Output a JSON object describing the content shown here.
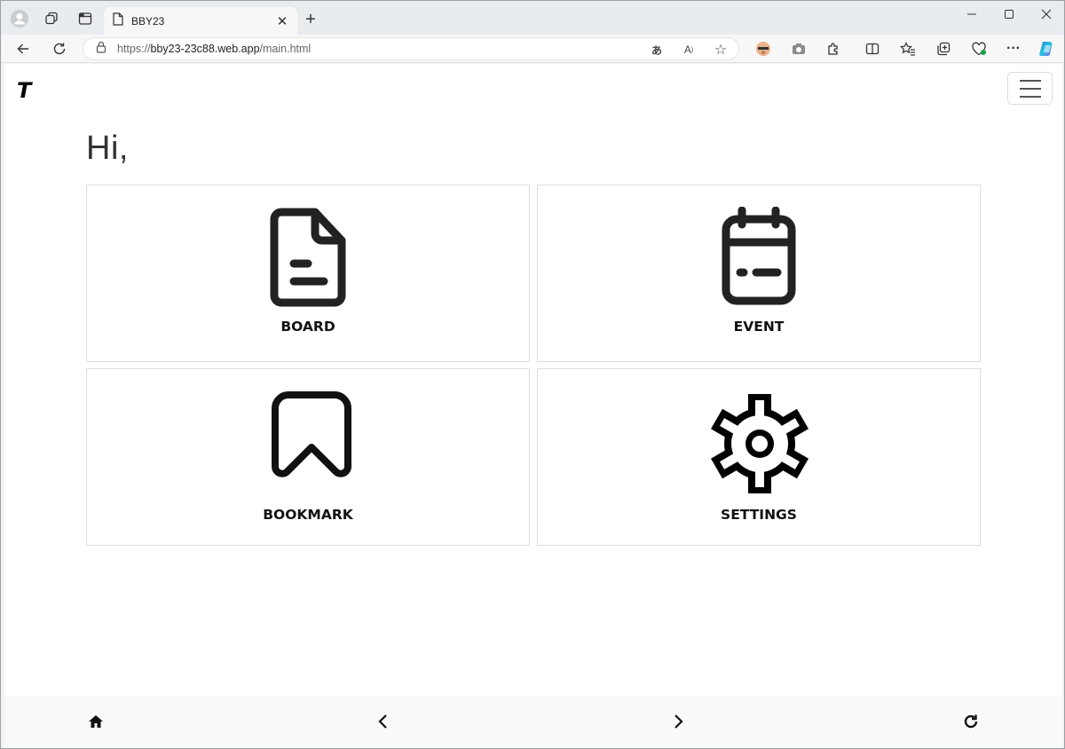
{
  "browser": {
    "tab_title": "BBY23",
    "url_prefix": "https://",
    "url_host": "bby23-23c88.web.app",
    "url_path": "/main.html",
    "icons": [
      "profile-icon",
      "workspaces-icon",
      "vertical-tabs-icon",
      "page-icon",
      "close-icon",
      "new-tab-icon",
      "minimize-icon",
      "maximize-icon",
      "close-window-icon",
      "back-icon",
      "refresh-icon",
      "lock-icon",
      "translate-icon",
      "read-aloud-icon",
      "favorite-star-icon",
      "extension-avatar-icon",
      "screenshot-icon",
      "extensions-icon",
      "split-screen-icon",
      "favorites-icon",
      "collections-icon",
      "browser-essentials-icon",
      "more-icon",
      "copilot-icon"
    ]
  },
  "app": {
    "brand": "T",
    "greeting": "Hi,",
    "cards": [
      {
        "label": "BOARD",
        "icon": "document-icon"
      },
      {
        "label": "EVENT",
        "icon": "calendar-icon"
      },
      {
        "label": "BOOKMARK",
        "icon": "bookmark-icon"
      },
      {
        "label": "SETTINGS",
        "icon": "gear-icon"
      }
    ],
    "bottom_nav": [
      "home-icon",
      "chevron-left-icon",
      "chevron-right-icon",
      "reload-icon"
    ]
  },
  "colors": {
    "icon": "#222222",
    "border": "#dcdcdc",
    "copilot": "#2b7de9"
  }
}
